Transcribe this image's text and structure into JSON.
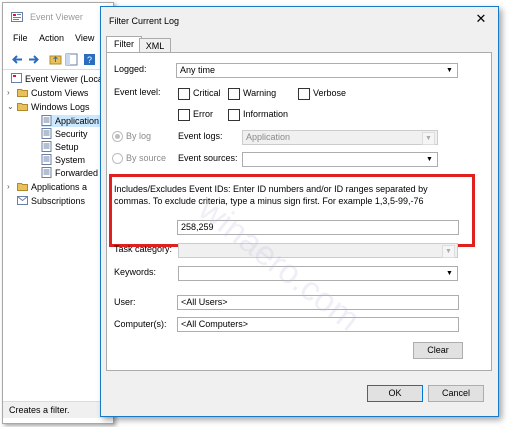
{
  "background_window": {
    "title": "Event Viewer",
    "menu": [
      "File",
      "Action",
      "View"
    ],
    "tree": [
      {
        "label": "Event Viewer (Local)",
        "shown": "Event Viewer (Loca"
      },
      {
        "label": "Custom Views"
      },
      {
        "label": "Windows Logs"
      },
      {
        "label": "Application"
      },
      {
        "label": "Security"
      },
      {
        "label": "Setup"
      },
      {
        "label": "System"
      },
      {
        "label": "Forwarded"
      },
      {
        "label": "Applications a"
      },
      {
        "label": "Subscriptions"
      }
    ],
    "status_text": "Creates a filter."
  },
  "dialog": {
    "title": "Filter Current Log",
    "tabs": [
      "Filter",
      "XML"
    ],
    "logged_label": "Logged:",
    "logged_value": "Any time",
    "event_level_label": "Event level:",
    "levels": [
      "Critical",
      "Warning",
      "Verbose",
      "Error",
      "Information"
    ],
    "by_log_label": "By log",
    "by_source_label": "By source",
    "event_logs_label": "Event logs:",
    "event_logs_value": "Application",
    "event_sources_label": "Event sources:",
    "event_ids_description": "Includes/Excludes Event IDs: Enter ID numbers and/or ID ranges separated by commas. To exclude criteria, type a minus sign first. For example 1,3,5-99,-76",
    "event_ids_value": "258,259",
    "task_category_label": "Task category:",
    "keywords_label": "Keywords:",
    "user_label": "User:",
    "user_value": "<All Users>",
    "computers_label": "Computer(s):",
    "computers_value": "<All Computers>",
    "clear_label": "Clear",
    "ok_label": "OK",
    "cancel_label": "Cancel",
    "close_glyph": "✕"
  },
  "watermark": "winaero.com",
  "colors": {
    "highlight": "#e0201f",
    "accent": "#0078d7"
  }
}
